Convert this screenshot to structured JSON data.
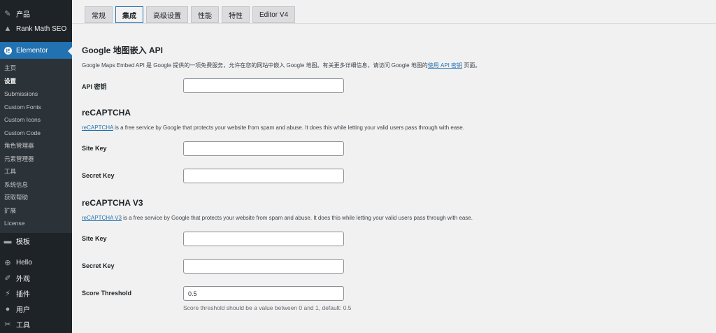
{
  "sidebar": {
    "top_item": {
      "label": "产品",
      "icon": "pin-icon"
    },
    "rank_math": {
      "label": "Rank Math SEO",
      "icon": "chart-icon"
    },
    "elementor": {
      "label": "Elementor",
      "icon": "elementor-icon"
    },
    "submenu": [
      "主页",
      "设置",
      "Submissions",
      "Custom Fonts",
      "Custom Icons",
      "Custom Code",
      "角色管理器",
      "元素管理器",
      "工具",
      "系统信息",
      "获取帮助",
      "扩展",
      "License"
    ],
    "templates": {
      "label": "模板",
      "icon": "folder-icon"
    },
    "hello": {
      "label": "Hello",
      "icon": "plus-circle-icon"
    },
    "appearance": {
      "label": "外观",
      "icon": "brush-icon"
    },
    "plugins": {
      "label": "插件",
      "icon": "plug-icon"
    },
    "users": {
      "label": "用户",
      "icon": "user-icon"
    },
    "tools": {
      "label": "工具",
      "icon": "wrench-icon"
    }
  },
  "tabs": [
    "常规",
    "集成",
    "高级设置",
    "性能",
    "特性",
    "Editor V4"
  ],
  "google_maps": {
    "title": "Google 地图嵌入 API",
    "desc_prefix": "Google Maps Embed API 是 Google 提供的一项免费服务，允许在您的网站中嵌入 Google 地图。有关更多详细信息，请访问 Google 地图的",
    "desc_link": "使用 API 密钥",
    "desc_suffix": " 页面。",
    "api_key_label": "API 密钥",
    "api_key_value": ""
  },
  "recaptcha": {
    "title": "reCAPTCHA",
    "desc_link": "reCAPTCHA",
    "desc_suffix": " is a free service by Google that protects your website from spam and abuse. It does this while letting your valid users pass through with ease.",
    "site_key_label": "Site Key",
    "site_key_value": "",
    "secret_key_label": "Secret Key",
    "secret_key_value": ""
  },
  "recaptcha_v3": {
    "title": "reCAPTCHA V3",
    "desc_link": "reCAPTCHA V3",
    "desc_suffix": " is a free service by Google that protects your website from spam and abuse. It does this while letting your valid users pass through with ease.",
    "site_key_label": "Site Key",
    "site_key_value": "",
    "secret_key_label": "Secret Key",
    "secret_key_value": "",
    "score_label": "Score Threshold",
    "score_value": "0.5",
    "score_help": "Score threshold should be a value between 0 and 1, default: 0.5"
  },
  "colors": {
    "accent": "#2271b1",
    "sidebar_bg": "#1d2327",
    "submenu_bg": "#2c3338"
  }
}
